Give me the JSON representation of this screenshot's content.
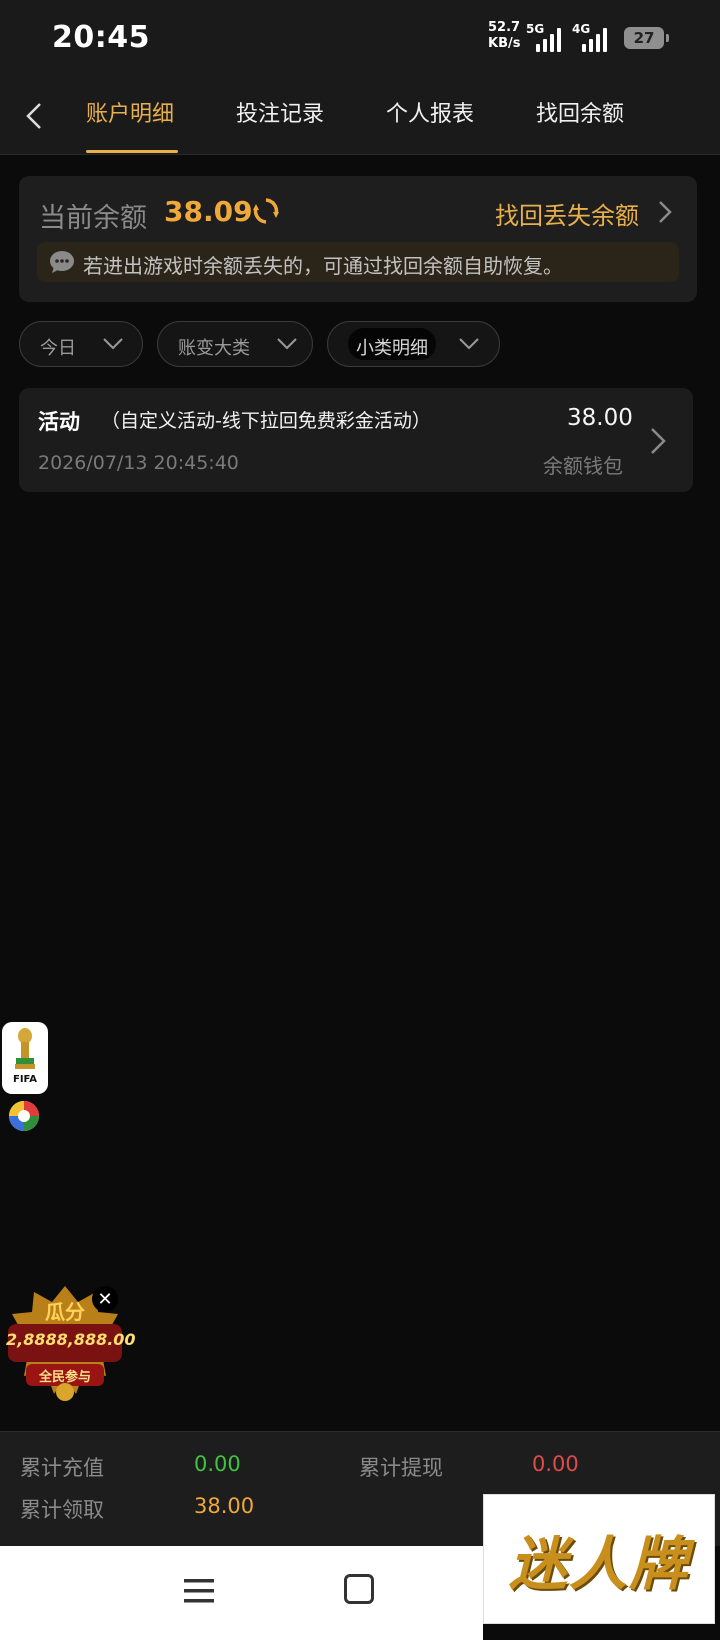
{
  "status_bar": {
    "time": "20:45",
    "net_speed_value": "52.7",
    "net_speed_unit": "KB/s",
    "signal1_label": "5G",
    "signal2_label": "4G",
    "battery_level": "27"
  },
  "nav": {
    "back_icon": "chevron-left-icon",
    "tabs": [
      {
        "label": "账户明细",
        "active": true
      },
      {
        "label": "投注记录",
        "active": false
      },
      {
        "label": "个人报表",
        "active": false
      },
      {
        "label": "找回余额",
        "active": false
      }
    ]
  },
  "balance": {
    "label": "当前余额",
    "value": "38.09",
    "recover_link": "找回丢失余额",
    "notice": "若进出游戏时余额丢失的，可通过找回余额自助恢复。"
  },
  "filters": [
    {
      "label": "今日"
    },
    {
      "label": "账变大类"
    },
    {
      "label": "小类明细"
    }
  ],
  "record": {
    "title_bold": "活动",
    "title_rest": "（自定义活动-线下拉回免费彩金活动）",
    "amount": "38.00",
    "time": "2026/07/13 20:45:40",
    "wallet": "余额钱包"
  },
  "floating": {
    "fifa_label": "FIFA",
    "promo_line1": "瓜分",
    "promo_line2": "2,8888,888.00",
    "promo_line3": "全民参与",
    "close_label": "✕"
  },
  "summary": {
    "recharge_label": "累计充值",
    "recharge_value": "0.00",
    "withdraw_label": "累计提现",
    "withdraw_value": "0.00",
    "claim_label": "累计领取",
    "claim_value": "38.00"
  },
  "colors": {
    "accent_gold": "#e8b04a",
    "balance_orange": "#f0a83a",
    "recharge_green": "#3fc43f",
    "withdraw_red": "#e24a4a"
  },
  "watermark": "迷人牌"
}
